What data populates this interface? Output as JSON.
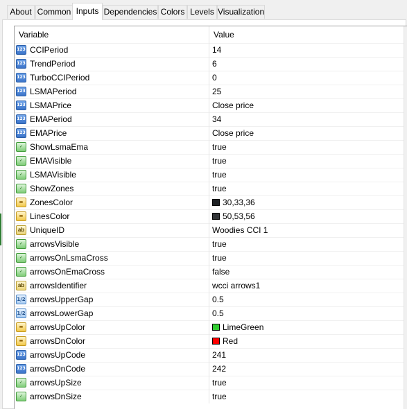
{
  "tabs": [
    {
      "label": "About",
      "active": false
    },
    {
      "label": "Common",
      "active": false
    },
    {
      "label": "Inputs",
      "active": true
    },
    {
      "label": "Dependencies",
      "active": false
    },
    {
      "label": "Colors",
      "active": false
    },
    {
      "label": "Levels",
      "active": false
    },
    {
      "label": "Visualization",
      "active": false
    }
  ],
  "table": {
    "headers": {
      "variable": "Variable",
      "value": "Value"
    },
    "rows": [
      {
        "name": "CCIPeriod",
        "value": "14",
        "type": "int",
        "icon": "integer-icon"
      },
      {
        "name": "TrendPeriod",
        "value": "6",
        "type": "int",
        "icon": "integer-icon"
      },
      {
        "name": "TurboCCIPeriod",
        "value": "0",
        "type": "int",
        "icon": "integer-icon"
      },
      {
        "name": "LSMAPeriod",
        "value": "25",
        "type": "int",
        "icon": "integer-icon"
      },
      {
        "name": "LSMAPrice",
        "value": "Close price",
        "type": "int",
        "icon": "integer-icon"
      },
      {
        "name": "EMAPeriod",
        "value": "34",
        "type": "int",
        "icon": "integer-icon"
      },
      {
        "name": "EMAPrice",
        "value": "Close price",
        "type": "int",
        "icon": "integer-icon"
      },
      {
        "name": "ShowLsmaEma",
        "value": "true",
        "type": "bool",
        "icon": "boolean-icon"
      },
      {
        "name": "EMAVisible",
        "value": "true",
        "type": "bool",
        "icon": "boolean-icon"
      },
      {
        "name": "LSMAVisible",
        "value": "true",
        "type": "bool",
        "icon": "boolean-icon"
      },
      {
        "name": "ShowZones",
        "value": "true",
        "type": "bool",
        "icon": "boolean-icon"
      },
      {
        "name": "ZonesColor",
        "value": "30,33,36",
        "type": "color",
        "icon": "color-icon",
        "swatch": "#1e2124"
      },
      {
        "name": "LinesColor",
        "value": "50,53,56",
        "type": "color",
        "icon": "color-icon",
        "swatch": "#323538"
      },
      {
        "name": "UniqueID",
        "value": "Woodies CCI 1",
        "type": "string",
        "icon": "string-icon"
      },
      {
        "name": "arrowsVisible",
        "value": "true",
        "type": "bool",
        "icon": "boolean-icon"
      },
      {
        "name": "arrowsOnLsmaCross",
        "value": "true",
        "type": "bool",
        "icon": "boolean-icon"
      },
      {
        "name": "arrowsOnEmaCross",
        "value": "false",
        "type": "bool",
        "icon": "boolean-icon"
      },
      {
        "name": "arrowsIdentifier",
        "value": "wcci arrows1",
        "type": "string",
        "icon": "string-icon"
      },
      {
        "name": "arrowsUpperGap",
        "value": "0.5",
        "type": "double",
        "icon": "double-icon"
      },
      {
        "name": "arrowsLowerGap",
        "value": "0.5",
        "type": "double",
        "icon": "double-icon"
      },
      {
        "name": "arrowsUpColor",
        "value": "LimeGreen",
        "type": "color",
        "icon": "color-icon",
        "swatch": "#32cd32"
      },
      {
        "name": "arrowsDnColor",
        "value": "Red",
        "type": "color",
        "icon": "color-icon",
        "swatch": "#ff0000"
      },
      {
        "name": "arrowsUpCode",
        "value": "241",
        "type": "int",
        "icon": "integer-icon"
      },
      {
        "name": "arrowsDnCode",
        "value": "242",
        "type": "int",
        "icon": "integer-icon"
      },
      {
        "name": "arrowsUpSize",
        "value": "true",
        "type": "bool",
        "icon": "boolean-icon"
      },
      {
        "name": "arrowsDnSize",
        "value": "true",
        "type": "bool",
        "icon": "boolean-icon"
      }
    ]
  },
  "icon_glyphs": {
    "int": "123",
    "double": "1/2",
    "bool": "✓",
    "color": "▬",
    "string": "ab"
  }
}
